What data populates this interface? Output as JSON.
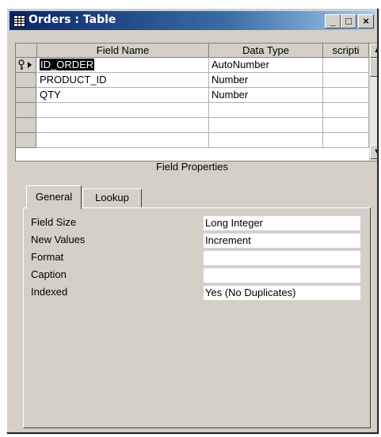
{
  "window": {
    "title": "Orders : Table"
  },
  "title_buttons": {
    "minimize": "_",
    "maximize": "□",
    "close": "×"
  },
  "grid": {
    "headers": [
      "Field Name",
      "Data Type",
      "scripti"
    ],
    "rows": [
      {
        "field_name": "ID_ORDER",
        "data_type": "AutoNumber",
        "description": "",
        "primary_key": true,
        "current": true
      },
      {
        "field_name": "PRODUCT_ID",
        "data_type": "Number",
        "description": ""
      },
      {
        "field_name": "QTY",
        "data_type": "Number",
        "description": ""
      },
      {
        "field_name": "",
        "data_type": "",
        "description": ""
      },
      {
        "field_name": "",
        "data_type": "",
        "description": ""
      },
      {
        "field_name": "",
        "data_type": "",
        "description": ""
      }
    ]
  },
  "field_properties": {
    "title": "Field Properties",
    "tabs": [
      "General",
      "Lookup"
    ],
    "active_tab": "General",
    "properties": [
      {
        "label": "Field Size",
        "value": "Long Integer"
      },
      {
        "label": "New Values",
        "value": "Increment"
      },
      {
        "label": "Format",
        "value": ""
      },
      {
        "label": "Caption",
        "value": ""
      },
      {
        "label": "Indexed",
        "value": "Yes (No Duplicates)"
      }
    ]
  },
  "icons": {
    "window_icon": "table-grid-icon",
    "primary_key": "key-icon",
    "current_row": "row-pointer-icon",
    "scroll_up": "arrow-up-icon",
    "scroll_down": "arrow-down-icon"
  }
}
